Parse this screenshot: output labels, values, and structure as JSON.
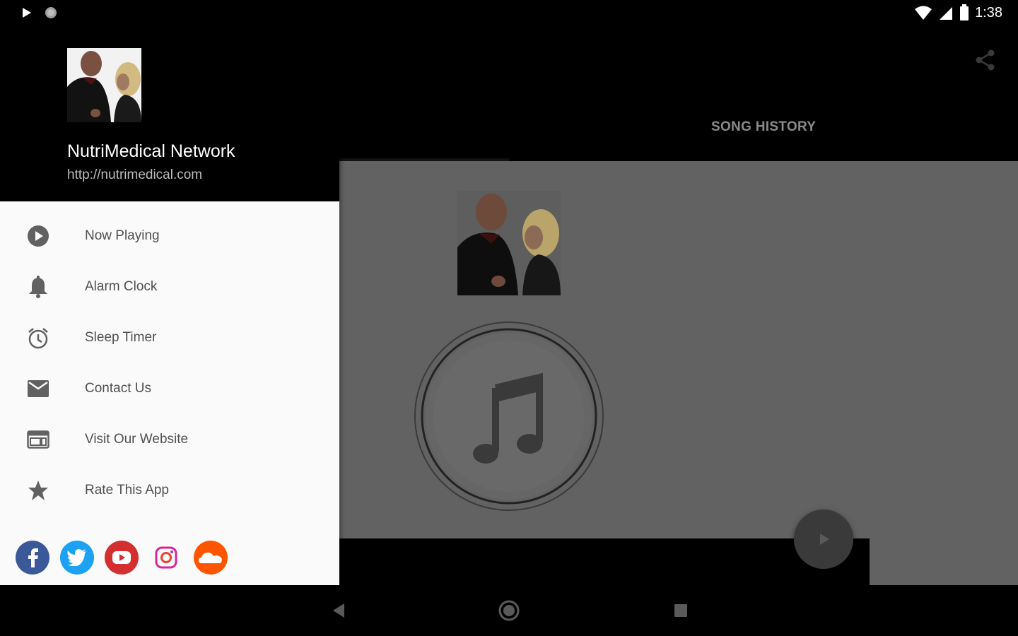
{
  "status_bar": {
    "time": "1:38",
    "left_icons": [
      "play-icon",
      "record-dot-icon"
    ],
    "right_icons": [
      "wifi-icon",
      "signal-icon",
      "battery-icon"
    ]
  },
  "drawer": {
    "station_name": "NutriMedical Network",
    "station_url": "http://nutrimedical.com",
    "menu_items": [
      {
        "label": "Now Playing",
        "icon": "play-circle-icon"
      },
      {
        "label": "Alarm Clock",
        "icon": "bell-icon"
      },
      {
        "label": "Sleep Timer",
        "icon": "alarm-clock-icon"
      },
      {
        "label": "Contact Us",
        "icon": "mail-icon"
      },
      {
        "label": "Visit Our Website",
        "icon": "web-icon"
      },
      {
        "label": "Rate This App",
        "icon": "star-icon"
      }
    ],
    "social": [
      {
        "name": "facebook",
        "color": "#3b5998"
      },
      {
        "name": "twitter",
        "color": "#1da1f2"
      },
      {
        "name": "youtube",
        "color": "#e52d27"
      },
      {
        "name": "instagram",
        "color": "#c13584"
      },
      {
        "name": "soundcloud",
        "color": "#ff5500"
      }
    ]
  },
  "main": {
    "tabs": [
      {
        "label": "",
        "selected": true
      },
      {
        "label": "SONG HISTORY",
        "selected": false
      }
    ]
  },
  "colors": {
    "drawer_bg": "#fafafa",
    "header_bg": "#000000",
    "scrim_content": "#626262",
    "menu_text": "#505050"
  }
}
